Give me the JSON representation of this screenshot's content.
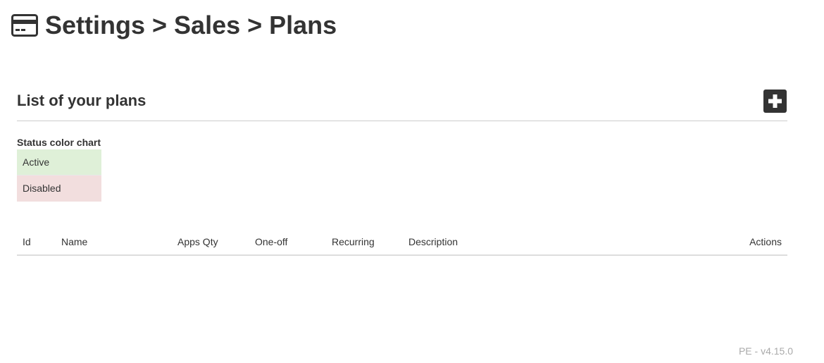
{
  "header": {
    "title": "Settings > Sales > Plans",
    "icon": "credit-card-icon"
  },
  "section": {
    "title": "List of your plans",
    "add_button_icon": "plus-icon"
  },
  "legend": {
    "title": "Status color chart",
    "items": [
      {
        "label": "Active",
        "color": "#dff0d8"
      },
      {
        "label": "Disabled",
        "color": "#f2dede"
      }
    ]
  },
  "table": {
    "columns": [
      "Id",
      "Name",
      "Apps Qty",
      "One-off",
      "Recurring",
      "Description",
      "Actions"
    ],
    "rows": []
  },
  "footer": {
    "version": "PE - v4.15.0"
  },
  "colors": {
    "text": "#333333",
    "button": "#333333",
    "active": "#dff0d8",
    "disabled": "#f2dede",
    "version": "#aaaaaa"
  }
}
